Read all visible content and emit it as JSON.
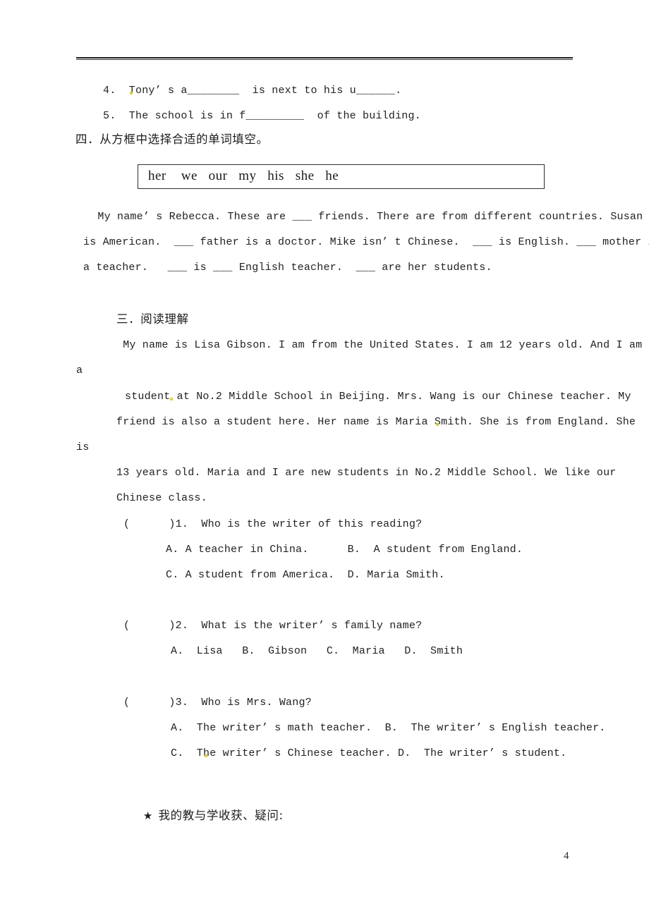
{
  "document": {
    "page_number": "4",
    "header_rule": true
  },
  "fill_in_blanks": {
    "items": [
      {
        "number": "4.",
        "text": "4.  Tony’ s a________  is next to his u______."
      },
      {
        "number": "5.",
        "text": "5.  The school is in f_________  of the building."
      }
    ]
  },
  "section_four": {
    "heading": "四．从方框中选择合适的单词填空。",
    "word_bank": {
      "words": [
        "her",
        "we",
        "our",
        "my",
        "his",
        "she",
        "he"
      ],
      "display": "her    we   our   my   his   she   he"
    },
    "cloze_lines": [
      "  My name’ s Rebecca. These are ___ friends. There are from different countries. Susan",
      "is American.  ___ father is a doctor. Mike isn’ t Chinese.  ___ is English. ___ mother is",
      "a teacher.   ___ is ___ English teacher.  ___ are her students."
    ]
  },
  "section_three": {
    "heading": "三．阅读理解",
    "passage_lines": [
      " My name is Lisa Gibson. I am from the United States. I am 12 years old. And I am",
      "a",
      "student at No.2 Middle School in Beijing. Mrs. Wang is our Chinese teacher. My",
      "friend is also a student here. Her name is Maria Smith. She is from England. She",
      "is",
      "13 years old. Maria and I are new students in No.2 Middle School. We like our",
      "Chinese class."
    ],
    "questions": [
      {
        "stem": "(      )1.  Who is the writer of this reading?",
        "option_lines": [
          "A. A teacher in China.      B.  A student from England.",
          "C. A student from America.  D. Maria Smith."
        ]
      },
      {
        "stem": "(      )2.  What is the writer’ s family name?",
        "option_lines": [
          "A.  Lisa   B.  Gibson   C.  Maria   D.  Smith"
        ]
      },
      {
        "stem": "(      )3.  Who is Mrs. Wang?",
        "option_lines": [
          "A.  The writer’ s math teacher.  B.  The writer’ s English teacher.",
          "C.  The writer’ s Chinese teacher. D.  The writer’ s student."
        ]
      }
    ]
  },
  "reflection": {
    "star_glyph": "★",
    "text": "我的教与学收获、疑问:"
  }
}
